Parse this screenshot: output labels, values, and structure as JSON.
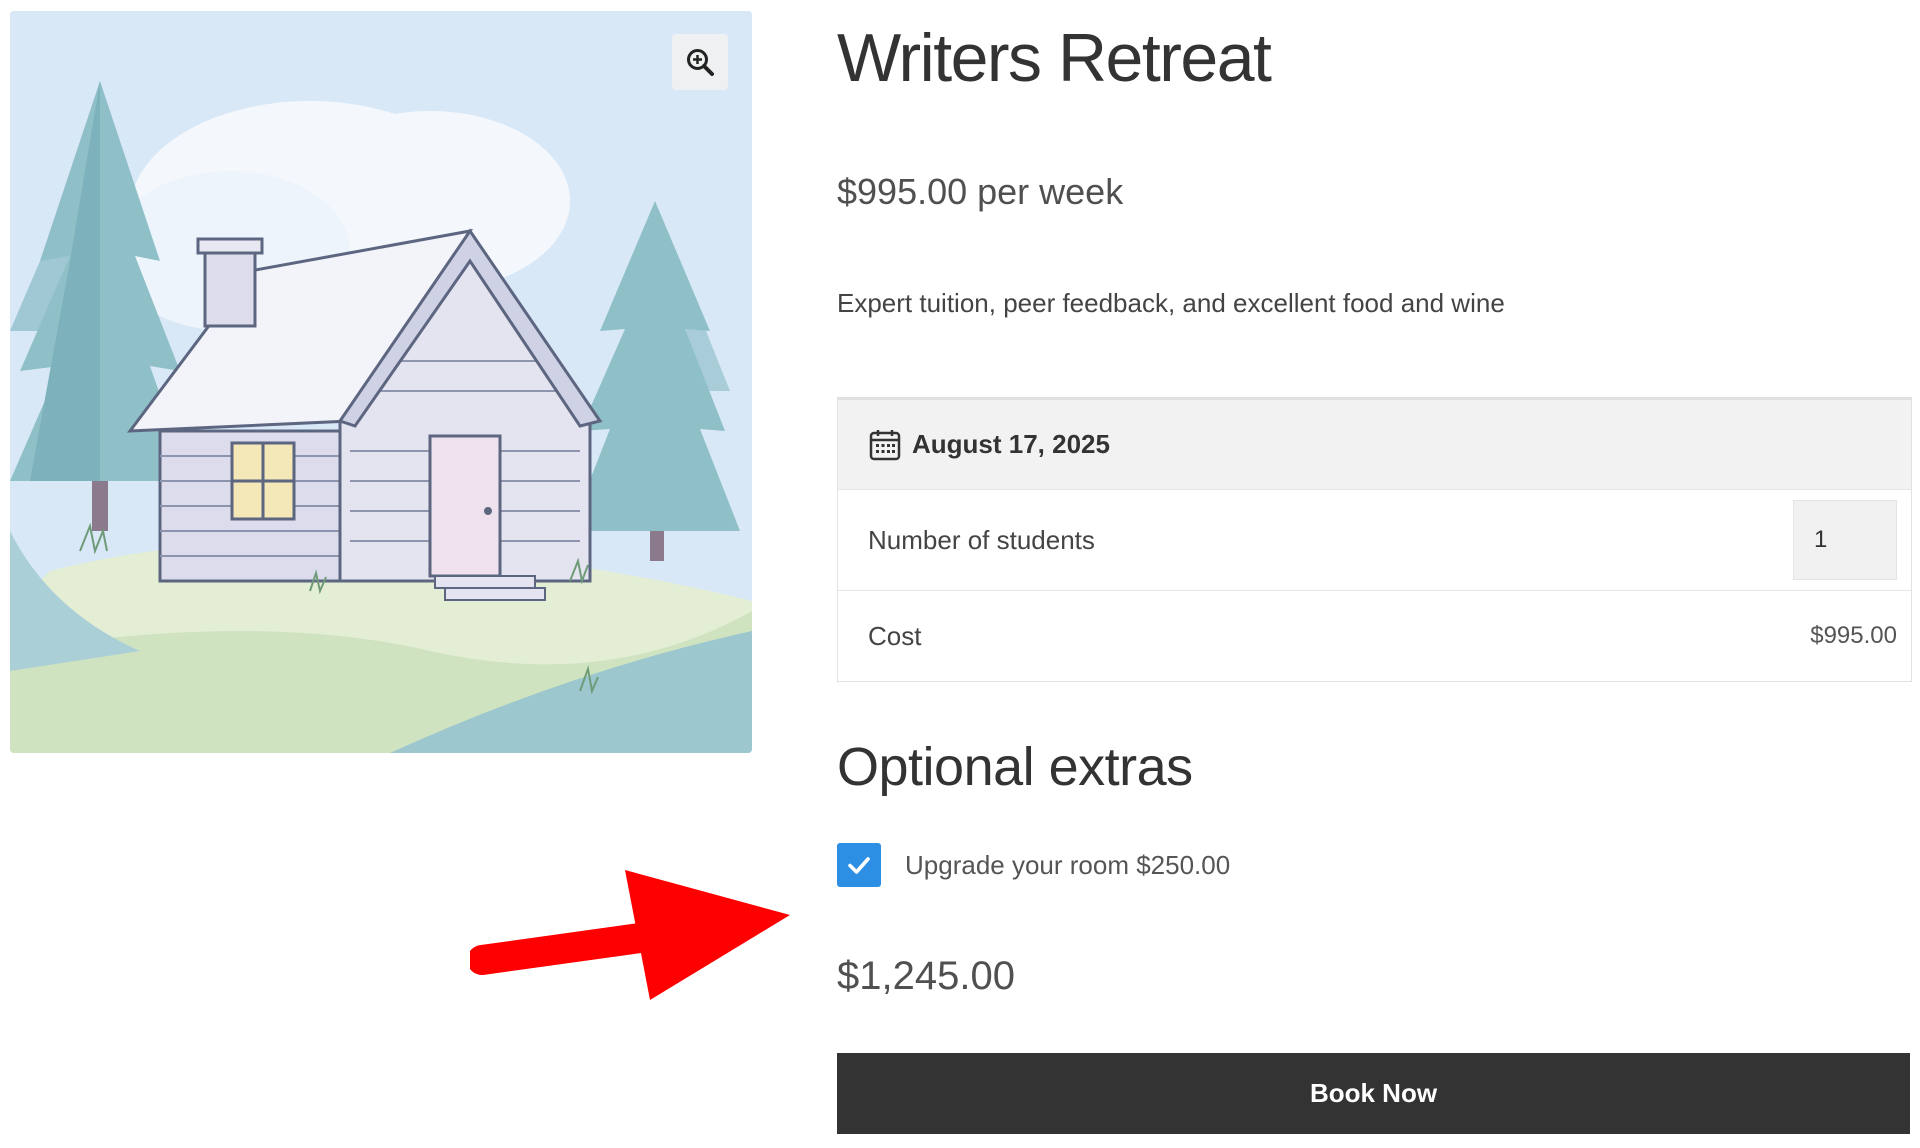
{
  "product": {
    "title": "Writers Retreat",
    "price": "$995.00 per week",
    "short_description": "Expert tuition, peer feedback, and excellent food and wine"
  },
  "gallery": {
    "zoom_icon": "zoom-in-icon"
  },
  "booking": {
    "calendar_icon": "calendar-icon",
    "date": "August 17, 2025",
    "students_label": "Number of students",
    "students_value": "1",
    "cost_label": "Cost",
    "cost_value": "$995.00"
  },
  "extras": {
    "heading": "Optional extras",
    "options": [
      {
        "label": "Upgrade your room $250.00",
        "checked": true
      }
    ]
  },
  "total": "$1,245.00",
  "actions": {
    "book_label": "Book Now"
  },
  "colors": {
    "button_bg": "#333333",
    "checkbox": "#2d8fe3",
    "date_row_bg": "#f2f2f2",
    "annotation_arrow": "#ff0000"
  }
}
